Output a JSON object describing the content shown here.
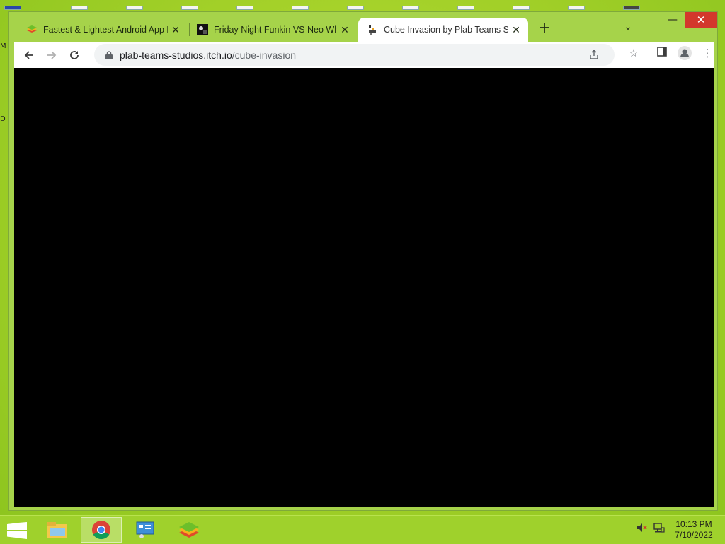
{
  "desktop": {
    "edge_letters": [
      "M",
      "D"
    ]
  },
  "window": {
    "tabs": [
      {
        "title": "Fastest & Lightest Android App F",
        "favicon": "bluestacks-icon",
        "active": false
      },
      {
        "title": "Friday Night Funkin VS Neo Whi",
        "favicon": "fnf-thumbnail-icon",
        "active": false
      },
      {
        "title": "Cube Invasion by Plab Teams Stu",
        "favicon": "itch-icon",
        "active": true
      }
    ],
    "controls": {
      "minimize": "—",
      "maximize": "☐",
      "close": "✕"
    }
  },
  "toolbar": {
    "url_host": "plab-teams-studios.itch.io",
    "url_path": "/cube-invasion"
  },
  "taskbar": {
    "apps": [
      {
        "name": "file-explorer",
        "active": false
      },
      {
        "name": "chrome",
        "active": true
      },
      {
        "name": "control-panel",
        "active": false
      },
      {
        "name": "bluestacks",
        "active": false
      }
    ],
    "time": "10:13 PM",
    "date": "7/10/2022"
  },
  "colors": {
    "desktop_bg": "#a6d22a",
    "tabstrip_bg": "#a6d34a",
    "content_bg": "#000000",
    "close_red": "#d3382c"
  }
}
